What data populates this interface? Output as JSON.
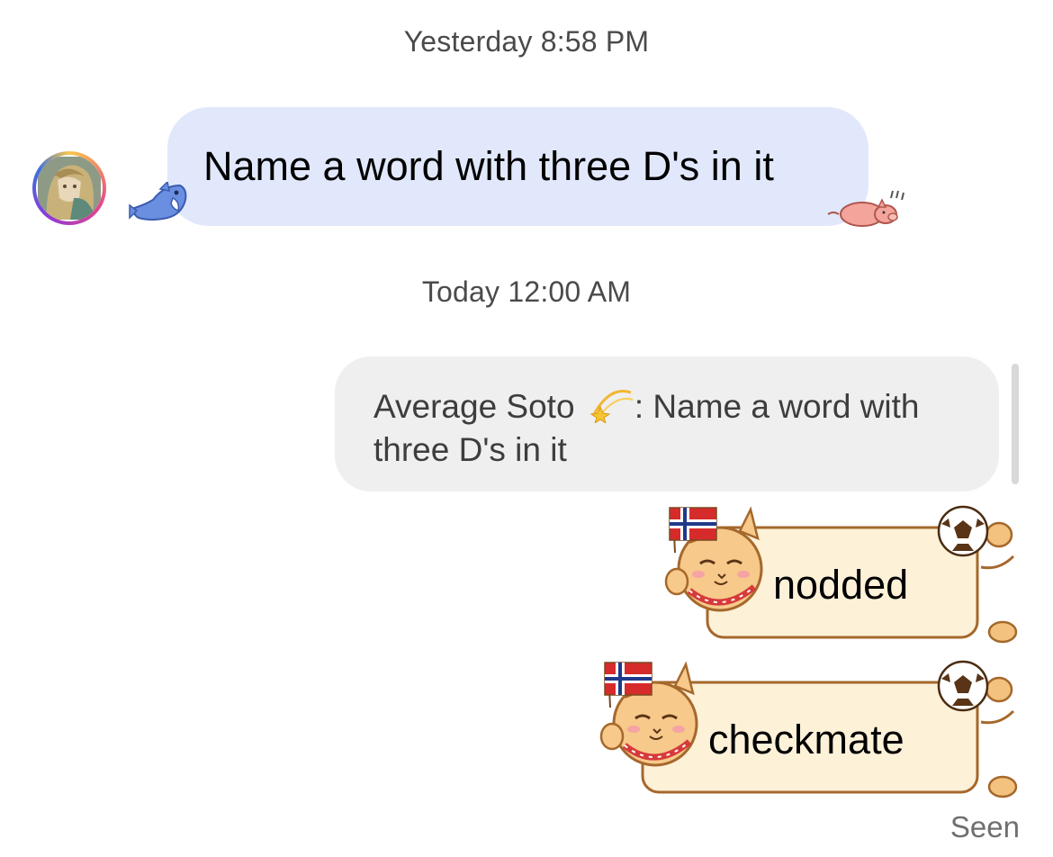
{
  "timestamps": {
    "first": "Yesterday 8:58 PM",
    "second": "Today 12:00 AM"
  },
  "incoming_message": {
    "text": "Name a word with three D's in it"
  },
  "reply_preview": {
    "sender": "Average Soto",
    "sender_emoji": "dizzy-comet-icon",
    "separator": ":",
    "text": "Name a word with three D's in it"
  },
  "outgoing_messages": [
    {
      "text": "nodded",
      "style": "cat-soccer-sticker-bubble"
    },
    {
      "text": "checkmate",
      "style": "cat-soccer-sticker-bubble"
    }
  ],
  "status": {
    "seen": "Seen"
  },
  "colors": {
    "incoming_bubble": "#e1e8fc",
    "reply_bubble": "#efefef",
    "sticker_fill": "#fdf1d8",
    "sticker_outline": "#a5682c"
  }
}
